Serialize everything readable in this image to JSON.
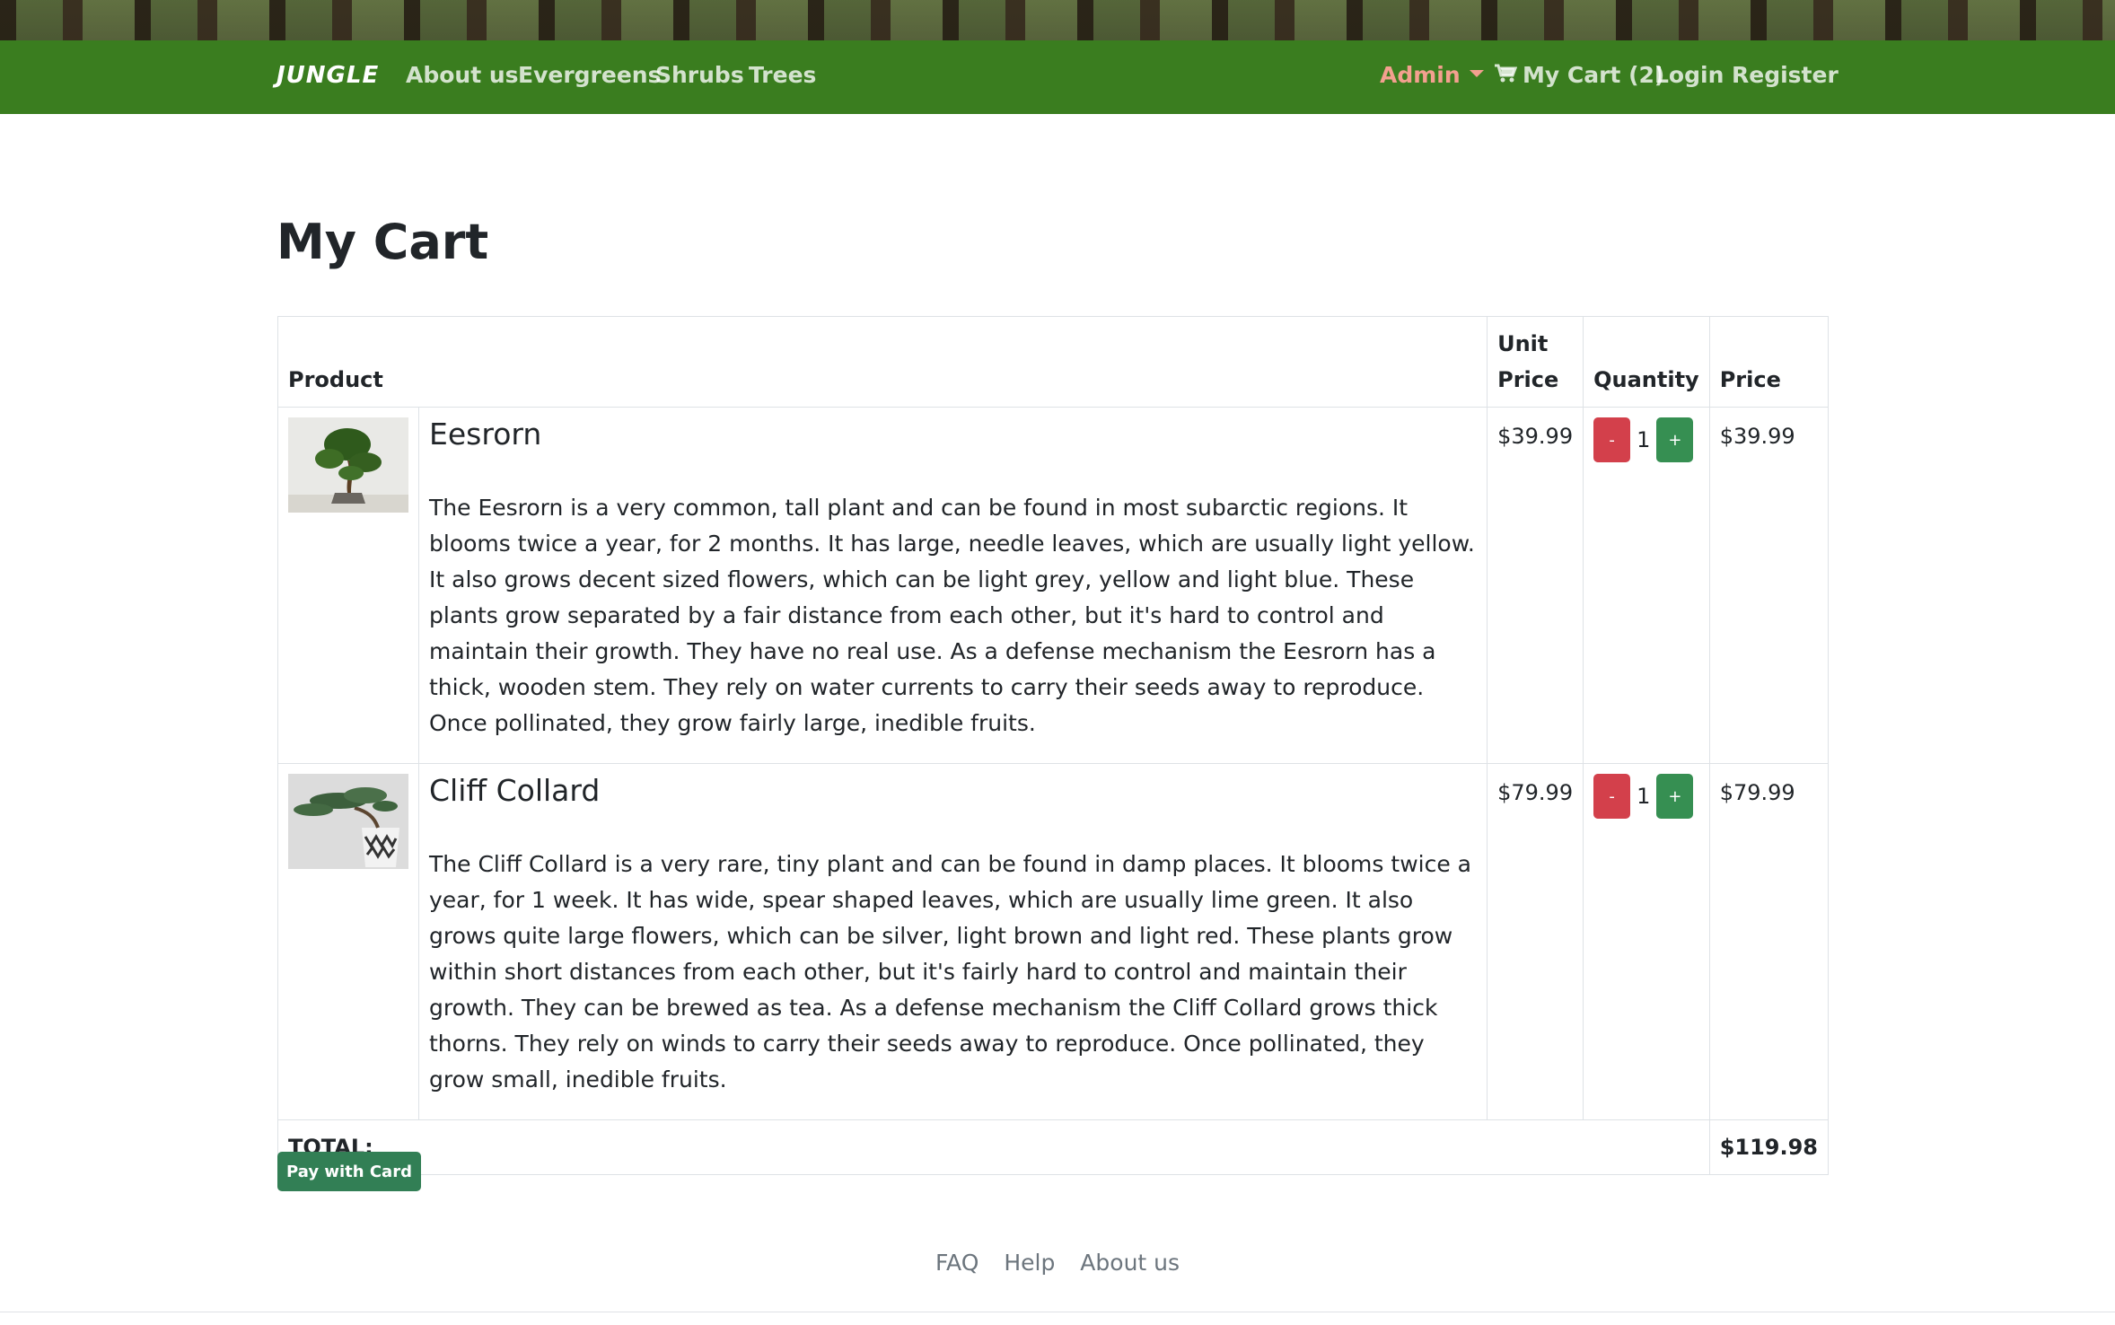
{
  "navbar": {
    "brand": "JUNGLE",
    "links": [
      "About us",
      "Evergreens",
      "Shrubs",
      "Trees"
    ],
    "admin": "Admin",
    "cart": "My Cart (2)",
    "login": "Login",
    "register": "Register",
    "background_color": "#3a7d1f",
    "admin_color": "#f3a08f"
  },
  "page": {
    "title": "My Cart"
  },
  "table": {
    "headers": {
      "product": "Product",
      "unit_price": "Unit Price",
      "quantity": "Quantity",
      "price": "Price"
    },
    "rows": [
      {
        "image": "bonsai-tree-image",
        "name": "Eesrorn",
        "description": "The Eesrorn is a very common, tall plant and can be found in most subarctic regions. It blooms twice a year, for 2 months. It has large, needle leaves, which are usually light yellow. It also grows decent sized flowers, which can be light grey, yellow and light blue. These plants grow separated by a fair distance from each other, but it's hard to control and maintain their growth. They have no real use. As a defense mechanism the Eesrorn has a thick, wooden stem. They rely on water currents to carry their seeds away to reproduce. Once pollinated, they grow fairly large, inedible fruits.",
        "unit_price": "$39.99",
        "quantity": "1",
        "price": "$39.99"
      },
      {
        "image": "juniper-bonsai-image",
        "name": "Cliff Collard",
        "description": "The Cliff Collard is a very rare, tiny plant and can be found in damp places. It blooms twice a year, for 1 week. It has wide, spear shaped leaves, which are usually lime green. It also grows quite large flowers, which can be silver, light brown and light red. These plants grow within short distances from each other, but it's fairly hard to control and maintain their growth. They can be brewed as tea. As a defense mechanism the Cliff Collard grows thick thorns. They rely on winds to carry their seeds away to reproduce. Once pollinated, they grow small, inedible fruits.",
        "unit_price": "$79.99",
        "quantity": "1",
        "price": "$79.99"
      }
    ],
    "qty_minus_label": "-",
    "qty_plus_label": "+",
    "total_label": "TOTAL:",
    "total_value": "$119.98"
  },
  "pay_button": "Pay with Card",
  "footer": {
    "links": [
      "FAQ",
      "Help",
      "About us"
    ]
  }
}
